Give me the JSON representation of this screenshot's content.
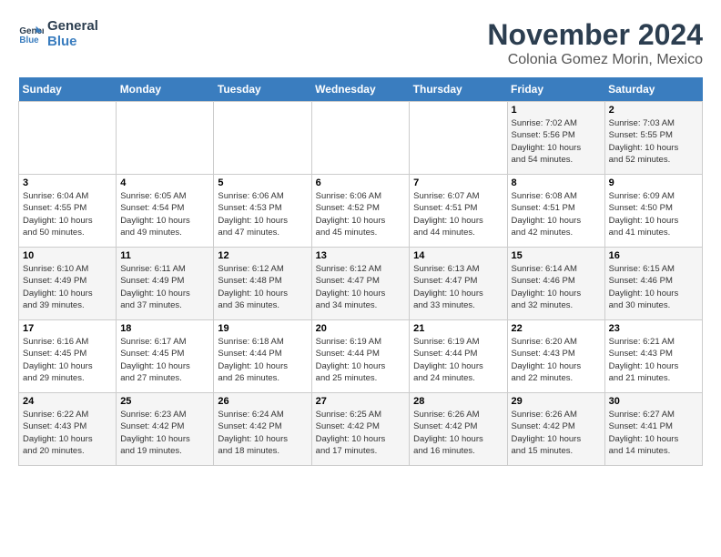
{
  "logo": {
    "line1": "General",
    "line2": "Blue"
  },
  "title": "November 2024",
  "location": "Colonia Gomez Morin, Mexico",
  "days_of_week": [
    "Sunday",
    "Monday",
    "Tuesday",
    "Wednesday",
    "Thursday",
    "Friday",
    "Saturday"
  ],
  "weeks": [
    [
      {
        "day": "",
        "info": ""
      },
      {
        "day": "",
        "info": ""
      },
      {
        "day": "",
        "info": ""
      },
      {
        "day": "",
        "info": ""
      },
      {
        "day": "",
        "info": ""
      },
      {
        "day": "1",
        "info": "Sunrise: 7:02 AM\nSunset: 5:56 PM\nDaylight: 10 hours\nand 54 minutes."
      },
      {
        "day": "2",
        "info": "Sunrise: 7:03 AM\nSunset: 5:55 PM\nDaylight: 10 hours\nand 52 minutes."
      }
    ],
    [
      {
        "day": "3",
        "info": "Sunrise: 6:04 AM\nSunset: 4:55 PM\nDaylight: 10 hours\nand 50 minutes."
      },
      {
        "day": "4",
        "info": "Sunrise: 6:05 AM\nSunset: 4:54 PM\nDaylight: 10 hours\nand 49 minutes."
      },
      {
        "day": "5",
        "info": "Sunrise: 6:06 AM\nSunset: 4:53 PM\nDaylight: 10 hours\nand 47 minutes."
      },
      {
        "day": "6",
        "info": "Sunrise: 6:06 AM\nSunset: 4:52 PM\nDaylight: 10 hours\nand 45 minutes."
      },
      {
        "day": "7",
        "info": "Sunrise: 6:07 AM\nSunset: 4:51 PM\nDaylight: 10 hours\nand 44 minutes."
      },
      {
        "day": "8",
        "info": "Sunrise: 6:08 AM\nSunset: 4:51 PM\nDaylight: 10 hours\nand 42 minutes."
      },
      {
        "day": "9",
        "info": "Sunrise: 6:09 AM\nSunset: 4:50 PM\nDaylight: 10 hours\nand 41 minutes."
      }
    ],
    [
      {
        "day": "10",
        "info": "Sunrise: 6:10 AM\nSunset: 4:49 PM\nDaylight: 10 hours\nand 39 minutes."
      },
      {
        "day": "11",
        "info": "Sunrise: 6:11 AM\nSunset: 4:49 PM\nDaylight: 10 hours\nand 37 minutes."
      },
      {
        "day": "12",
        "info": "Sunrise: 6:12 AM\nSunset: 4:48 PM\nDaylight: 10 hours\nand 36 minutes."
      },
      {
        "day": "13",
        "info": "Sunrise: 6:12 AM\nSunset: 4:47 PM\nDaylight: 10 hours\nand 34 minutes."
      },
      {
        "day": "14",
        "info": "Sunrise: 6:13 AM\nSunset: 4:47 PM\nDaylight: 10 hours\nand 33 minutes."
      },
      {
        "day": "15",
        "info": "Sunrise: 6:14 AM\nSunset: 4:46 PM\nDaylight: 10 hours\nand 32 minutes."
      },
      {
        "day": "16",
        "info": "Sunrise: 6:15 AM\nSunset: 4:46 PM\nDaylight: 10 hours\nand 30 minutes."
      }
    ],
    [
      {
        "day": "17",
        "info": "Sunrise: 6:16 AM\nSunset: 4:45 PM\nDaylight: 10 hours\nand 29 minutes."
      },
      {
        "day": "18",
        "info": "Sunrise: 6:17 AM\nSunset: 4:45 PM\nDaylight: 10 hours\nand 27 minutes."
      },
      {
        "day": "19",
        "info": "Sunrise: 6:18 AM\nSunset: 4:44 PM\nDaylight: 10 hours\nand 26 minutes."
      },
      {
        "day": "20",
        "info": "Sunrise: 6:19 AM\nSunset: 4:44 PM\nDaylight: 10 hours\nand 25 minutes."
      },
      {
        "day": "21",
        "info": "Sunrise: 6:19 AM\nSunset: 4:44 PM\nDaylight: 10 hours\nand 24 minutes."
      },
      {
        "day": "22",
        "info": "Sunrise: 6:20 AM\nSunset: 4:43 PM\nDaylight: 10 hours\nand 22 minutes."
      },
      {
        "day": "23",
        "info": "Sunrise: 6:21 AM\nSunset: 4:43 PM\nDaylight: 10 hours\nand 21 minutes."
      }
    ],
    [
      {
        "day": "24",
        "info": "Sunrise: 6:22 AM\nSunset: 4:43 PM\nDaylight: 10 hours\nand 20 minutes."
      },
      {
        "day": "25",
        "info": "Sunrise: 6:23 AM\nSunset: 4:42 PM\nDaylight: 10 hours\nand 19 minutes."
      },
      {
        "day": "26",
        "info": "Sunrise: 6:24 AM\nSunset: 4:42 PM\nDaylight: 10 hours\nand 18 minutes."
      },
      {
        "day": "27",
        "info": "Sunrise: 6:25 AM\nSunset: 4:42 PM\nDaylight: 10 hours\nand 17 minutes."
      },
      {
        "day": "28",
        "info": "Sunrise: 6:26 AM\nSunset: 4:42 PM\nDaylight: 10 hours\nand 16 minutes."
      },
      {
        "day": "29",
        "info": "Sunrise: 6:26 AM\nSunset: 4:42 PM\nDaylight: 10 hours\nand 15 minutes."
      },
      {
        "day": "30",
        "info": "Sunrise: 6:27 AM\nSunset: 4:41 PM\nDaylight: 10 hours\nand 14 minutes."
      }
    ]
  ]
}
